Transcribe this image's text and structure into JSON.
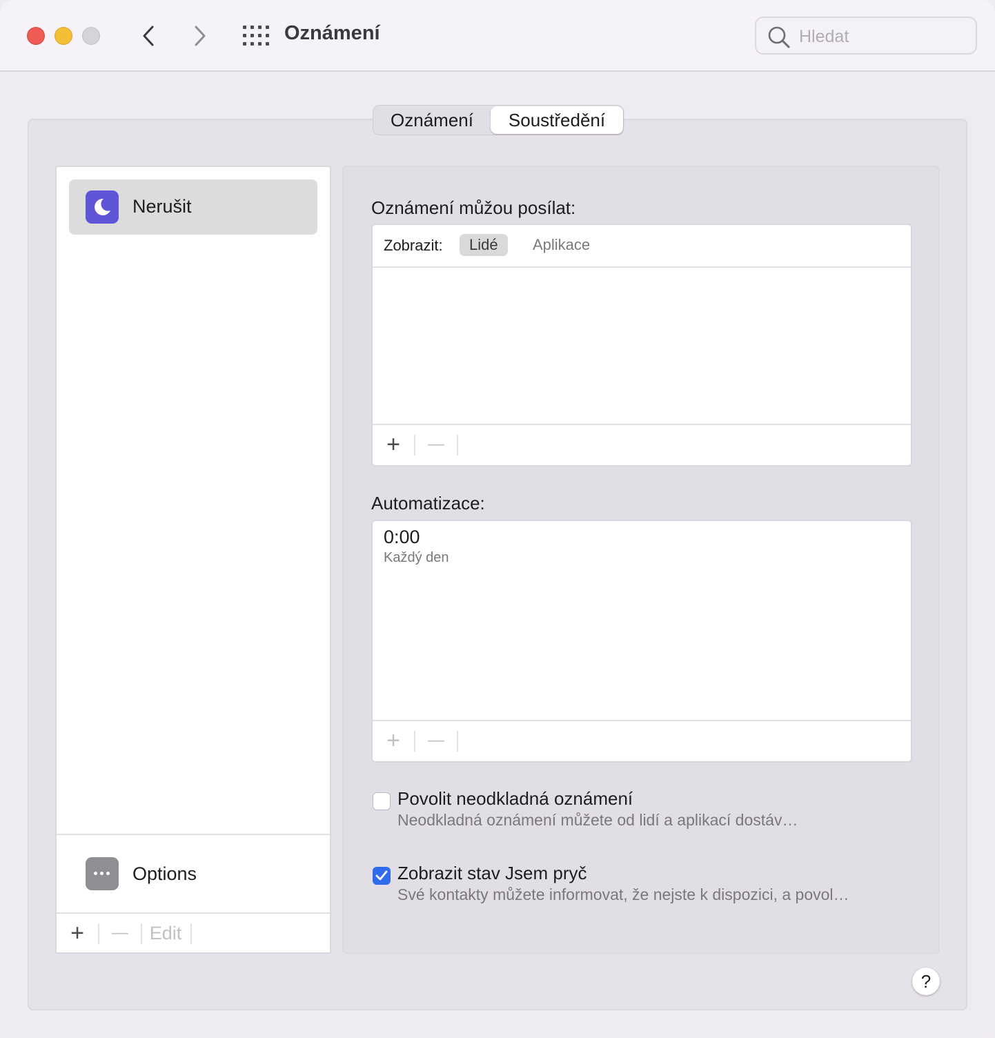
{
  "window": {
    "title": "Oznámení",
    "search_placeholder": "Hledat"
  },
  "tabs": [
    {
      "label": "Oznámení",
      "selected": false
    },
    {
      "label": "Soustředění",
      "selected": true
    }
  ],
  "focus_list": {
    "items": [
      {
        "label": "Nerušit",
        "icon": "moon-icon",
        "selected": true,
        "icon_color": "#5e56d6"
      }
    ],
    "options_label": "Options",
    "footer": {
      "add": "+",
      "remove": "—",
      "edit": "Edit"
    }
  },
  "allowed": {
    "title": "Oznámení můžou posílat:",
    "show_label": "Zobrazit:",
    "filters": [
      {
        "label": "Lidé",
        "selected": true
      },
      {
        "label": "Aplikace",
        "selected": false
      }
    ],
    "footer": {
      "add": "+",
      "remove": "—"
    }
  },
  "automation": {
    "title": "Automatizace:",
    "items": [
      {
        "time": "0:00",
        "repeat": "Každý den"
      }
    ],
    "footer": {
      "add": "+",
      "remove": "—"
    }
  },
  "options": [
    {
      "title": "Povolit neodkladná oznámení",
      "subtitle": "Neodkladná oznámení můžete od lidí a aplikací dostáv…",
      "checked": false
    },
    {
      "title": "Zobrazit stav Jsem pryč",
      "subtitle": "Své kontakty můžete informovat, že nejste k dispozici, a povol…",
      "checked": true
    }
  ],
  "help": "?",
  "colors": {
    "accent": "#2f6bea",
    "close": "#ee5b54",
    "minimize": "#f4be34"
  }
}
